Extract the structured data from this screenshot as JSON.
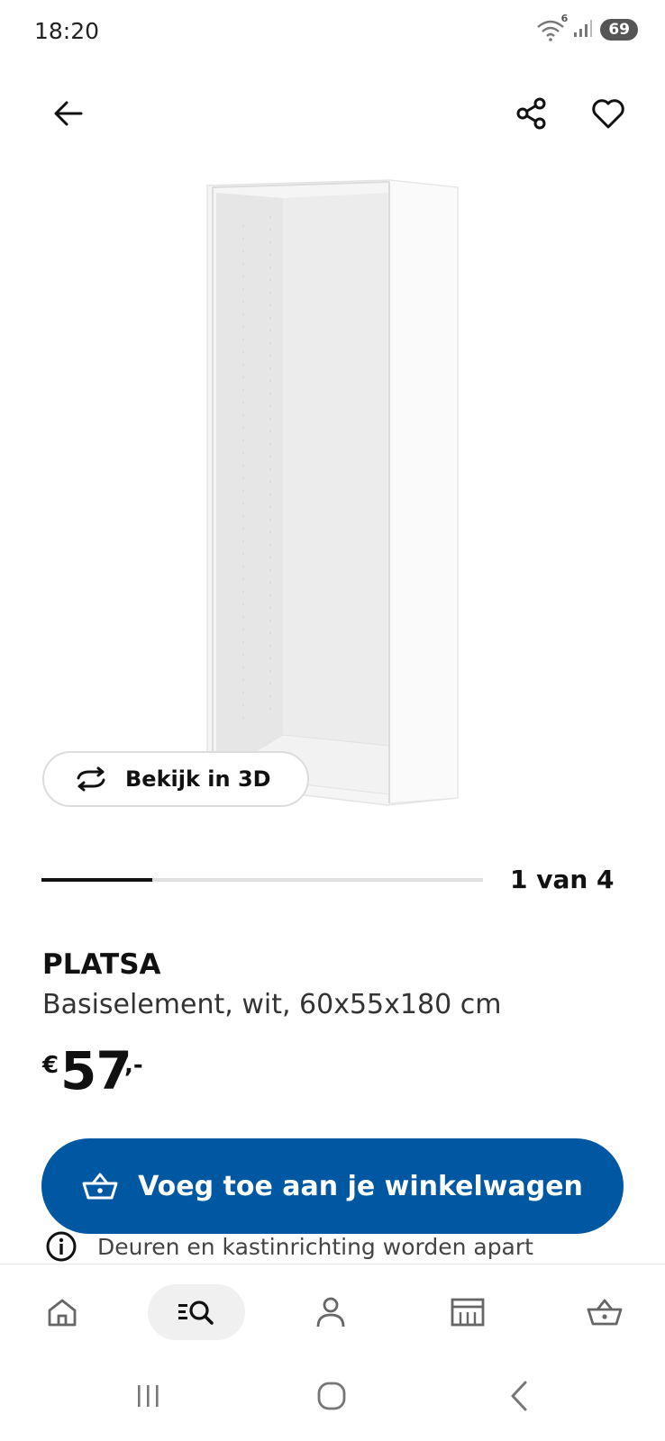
{
  "status_bar": {
    "time": "18:20",
    "wifi_badge": "6",
    "battery": "69"
  },
  "top_bar": {
    "back_icon": "arrow-left-icon",
    "share_icon": "share-icon",
    "favorite_icon": "heart-icon"
  },
  "gallery": {
    "view_3d_label": "Bekijk in 3D",
    "counter": "1 van 4",
    "current_index": 1,
    "total": 4
  },
  "product": {
    "name": "PLATSA",
    "description": "Basiselement, wit, 60x55x180 cm",
    "price_currency": "€",
    "price_whole": "57",
    "price_suffix": ",-"
  },
  "cta": {
    "add_to_cart_label": "Voeg toe aan je winkelwagen"
  },
  "info": {
    "note": "Deuren en kastinrichting worden apart"
  },
  "bottom_nav": {
    "items": [
      {
        "icon": "home-icon",
        "active": false
      },
      {
        "icon": "search-icon",
        "active": true
      },
      {
        "icon": "account-icon",
        "active": false
      },
      {
        "icon": "store-icon",
        "active": false
      },
      {
        "icon": "cart-icon",
        "active": false
      }
    ]
  },
  "colors": {
    "primary": "#0058a3",
    "text": "#111111",
    "progress_track": "#dfdfdf"
  }
}
